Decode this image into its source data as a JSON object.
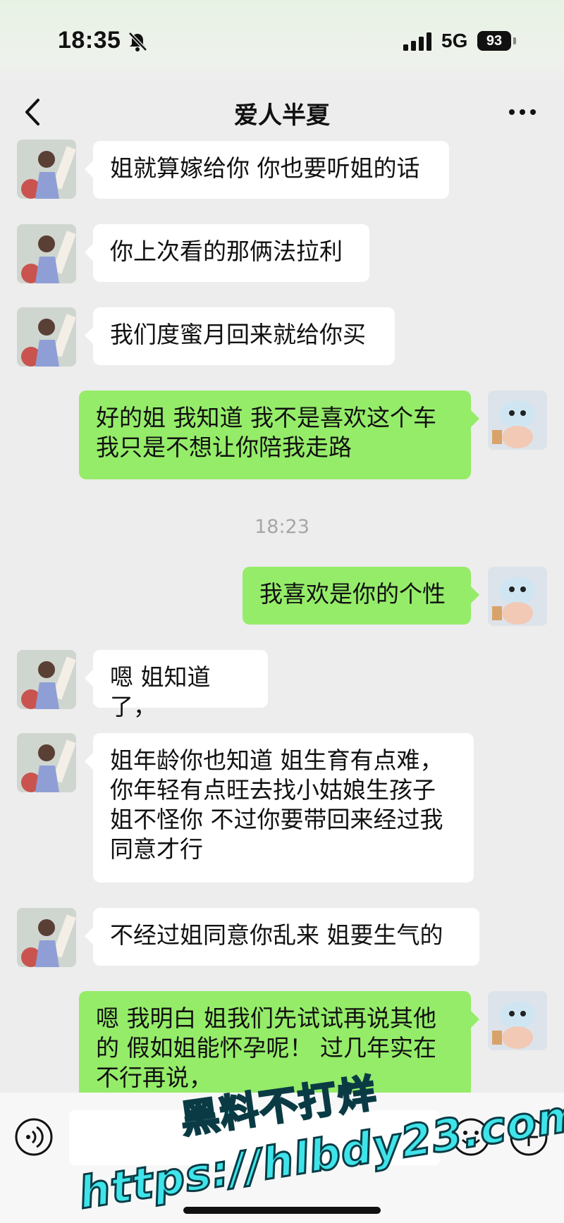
{
  "status_bar": {
    "time": "18:35",
    "network": "5G",
    "battery": "93"
  },
  "header": {
    "title": "爱人半夏"
  },
  "messages": [
    {
      "side": "in",
      "text": "姐就算嫁给你 你也要听姐的话"
    },
    {
      "side": "in",
      "text": "你上次看的那俩法拉利"
    },
    {
      "side": "in",
      "text": "我们度蜜月回来就给你买"
    },
    {
      "side": "out",
      "text": "好的姐  我知道 我不是喜欢这个车\n我只是不想让你陪我走路"
    },
    {
      "side": "out",
      "text": "我喜欢是你的个性"
    },
    {
      "side": "in",
      "text": "嗯 姐知道了，"
    },
    {
      "side": "in",
      "text": "姐年龄你也知道 姐生育有点难，\n你年轻有点旺去找小姑娘生孩子\n姐不怪你 不过你要带回来经过我\n同意才行"
    },
    {
      "side": "in",
      "text": "不经过姐同意你乱来  姐要生气的"
    },
    {
      "side": "out",
      "text": "嗯 我明白  姐我们先试试再说其他\n的 假如姐能怀孕呢！ 过几年实在\n不行再说，"
    }
  ],
  "timestamp": "18:23",
  "watermark": {
    "line1": "黑料不打烊",
    "line2": "https://hlbdy23.com"
  },
  "colors": {
    "outgoing_bubble": "#95ec69",
    "incoming_bubble": "#ffffff",
    "background": "#ededed",
    "watermark": "#3fe4ea"
  },
  "icons": [
    "mute-icon",
    "signal-icon",
    "back-icon",
    "more-icon",
    "voice-icon",
    "emoji-icon",
    "plus-icon"
  ]
}
